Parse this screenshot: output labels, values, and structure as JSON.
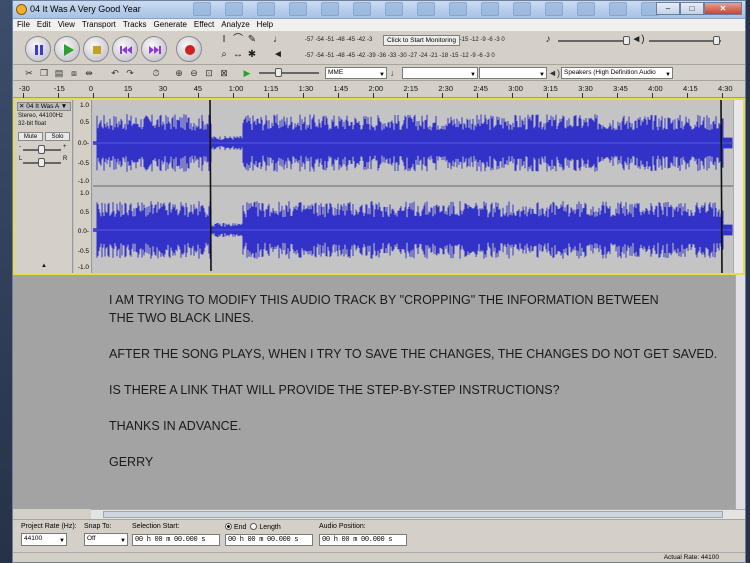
{
  "window": {
    "title": "04 It Was A Very Good Year",
    "min": "–",
    "max": "□",
    "close": "✕"
  },
  "menu": [
    "File",
    "Edit",
    "View",
    "Transport",
    "Tracks",
    "Generate",
    "Effect",
    "Analyze",
    "Help"
  ],
  "meters": {
    "record_scale": "-57 -54 -51 -48 -45 -42 -3",
    "record_scale_right": "21 -18 -15 -12  -9  -6  -3  0",
    "monitor_label": "Click to Start Monitoring",
    "play_scale": "-57 -54 -51 -48 -45 -42 -39 -36 -33 -30 -27 -24 -21 -18 -15 -12  -9  -6  -3  0"
  },
  "devices": {
    "host": "MME",
    "output": "Speakers (High Definition Audio"
  },
  "ruler": [
    "-30",
    "-15",
    "0",
    "15",
    "30",
    "45",
    "1:00",
    "1:15",
    "1:30",
    "1:45",
    "2:00",
    "2:15",
    "2:30",
    "2:45",
    "3:00",
    "3:15",
    "3:30",
    "3:45",
    "4:00",
    "4:15",
    "4:30"
  ],
  "track": {
    "name": "04 It Was A",
    "close": "✕",
    "menu": "▼",
    "info1": "Stereo, 44100Hz",
    "info2": "32-bit float",
    "mute": "Mute",
    "solo": "Solo",
    "gain_minus": "-",
    "gain_plus": "+",
    "pan_left": "L",
    "pan_right": "R",
    "collapse": "▲",
    "scale": [
      "1.0",
      "0.5",
      "0.0-",
      "-0.5",
      "-1.0"
    ]
  },
  "message": [
    "I AM TRYING TO MODIFY THIS AUDIO TRACK BY \"CROPPING\" THE INFORMATION BETWEEN\nTHE TWO BLACK LINES.",
    "AFTER THE SONG PLAYS, WHEN I TRY TO SAVE THE CHANGES, THE CHANGES DO NOT GET SAVED.",
    "IS THERE A LINK THAT WILL PROVIDE THE STEP-BY-STEP INSTRUCTIONS?",
    "THANKS IN ADVANCE.",
    "GERRY"
  ],
  "selection": {
    "rate_label": "Project Rate (Hz):",
    "rate_value": "44100",
    "snap_label": "Snap To:",
    "snap_value": "Off",
    "start_label": "Selection Start:",
    "start_value": "00 h 00 m 00.000 s",
    "end_label": "End",
    "length_label": "Length",
    "end_value": "00 h 00 m 00.000 s",
    "pos_label": "Audio Position:",
    "pos_value": "00 h 00 m 00.000 s"
  },
  "status": {
    "actual_rate": "Actual Rate: 44100"
  }
}
